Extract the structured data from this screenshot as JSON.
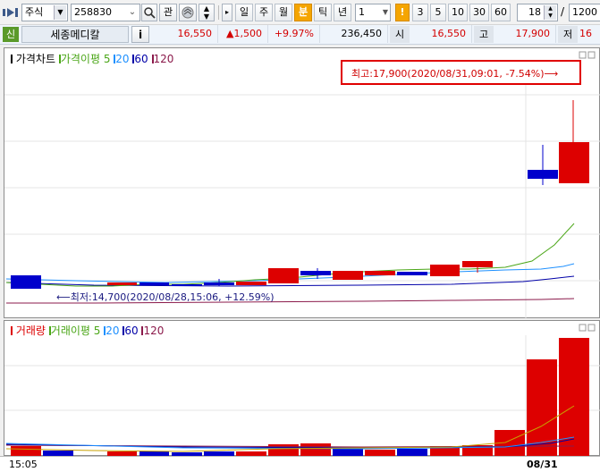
{
  "toolbar": {
    "market_select": "주식",
    "code_value": "258830",
    "search_icon": "search-icon",
    "favorite_label": "관",
    "period_buttons": [
      "일",
      "주",
      "월",
      "분",
      "틱",
      "년"
    ],
    "selected_period": "분",
    "interval_value": "1",
    "minute_options": [
      "3",
      "5",
      "10",
      "30",
      "60"
    ],
    "selected_minute_marker": "!",
    "count_value": "18",
    "separator": "/",
    "total_value": "1200"
  },
  "quote": {
    "badge": "신",
    "stock_name": "세종메디칼",
    "info_button": "i",
    "price": "16,550",
    "change": "▲1,500",
    "change_pct": "+9.97%",
    "volume": "236,450",
    "open_label": "시",
    "open_value": "16,550",
    "high_label": "고",
    "high_value": "17,900",
    "low_label": "저",
    "low_value": "16"
  },
  "price_chart": {
    "legend_title": "가격차트",
    "legend_ma_label": "가격이평",
    "legend_ma_periods": [
      "5",
      "20",
      "60",
      "120"
    ],
    "high_annotation": "최고:17,900(2020/08/31,09:01, -7.54%)⟶",
    "low_annotation": "⟵최저:14,700(2020/08/28,15:06, +12.59%)",
    "colors": {
      "up": "#dd0000",
      "down": "#0000cc",
      "ma5": "#4aa617",
      "ma20": "#1e90ff",
      "ma60": "#0000a8",
      "ma120": "#8b1a4b"
    }
  },
  "volume_chart": {
    "legend_title": "거래량",
    "legend_ma_label": "거래이평",
    "legend_ma_periods": [
      "5",
      "20",
      "60",
      "120"
    ],
    "x_labels": [
      "15:05",
      "08/31"
    ]
  }
}
